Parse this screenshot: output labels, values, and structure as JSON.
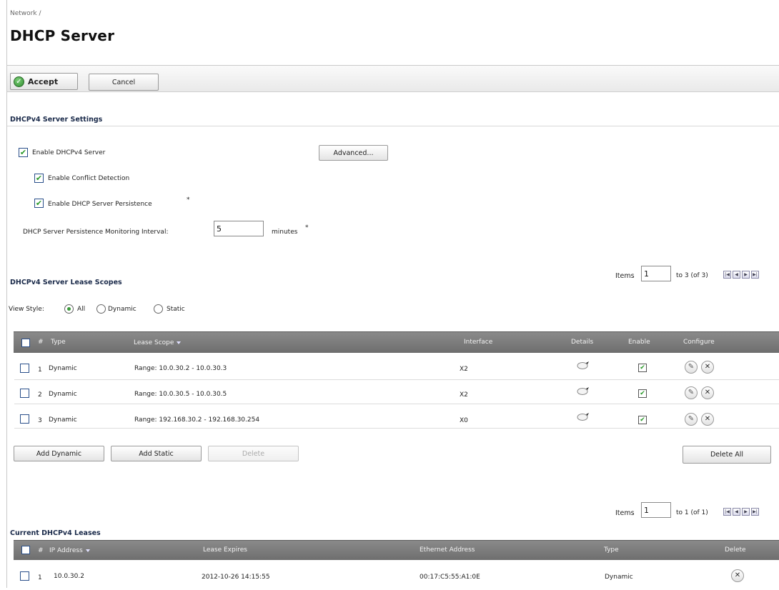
{
  "breadcrumb": "Network /",
  "page_title": "DHCP Server",
  "toolbar": {
    "accept_label": "Accept",
    "cancel_label": "Cancel"
  },
  "v4_settings": {
    "title": "DHCPv4 Server Settings",
    "enable_server": {
      "label": "Enable DHCPv4 Server",
      "checked": true
    },
    "advanced_label": "Advanced...",
    "conflict_detection": {
      "label": "Enable Conflict Detection",
      "checked": true
    },
    "persistence": {
      "label": "Enable DHCP Server Persistence",
      "checked": true,
      "asterisk": "*"
    },
    "interval": {
      "label": "DHCP Server Persistence Monitoring Interval:",
      "value": "5",
      "unit": "minutes",
      "asterisk": "*"
    }
  },
  "scopes": {
    "title": "DHCPv4 Server Lease Scopes",
    "pager": {
      "items_label": "Items",
      "current": "1",
      "range_text": "to 3 (of 3)"
    },
    "view_style": {
      "label": "View Style:",
      "options": [
        "All",
        "Dynamic",
        "Static"
      ],
      "selected": "All"
    },
    "columns": {
      "num": "#",
      "type": "Type",
      "lease_scope": "Lease Scope",
      "interface": "Interface",
      "details": "Details",
      "enable": "Enable",
      "configure": "Configure"
    },
    "rows": [
      {
        "num": "1",
        "type": "Dynamic",
        "lease_scope": "Range: 10.0.30.2 - 10.0.30.3",
        "interface": "X2",
        "enabled": true
      },
      {
        "num": "2",
        "type": "Dynamic",
        "lease_scope": "Range: 10.0.30.5 - 10.0.30.5",
        "interface": "X2",
        "enabled": true
      },
      {
        "num": "3",
        "type": "Dynamic",
        "lease_scope": "Range: 192.168.30.2 - 192.168.30.254",
        "interface": "X0",
        "enabled": true
      }
    ],
    "buttons": {
      "add_dynamic": "Add Dynamic",
      "add_static": "Add Static",
      "delete": "Delete",
      "delete_all": "Delete All"
    }
  },
  "leases": {
    "title": "Current DHCPv4 Leases",
    "pager": {
      "items_label": "Items",
      "current": "1",
      "range_text": "to 1 (of 1)"
    },
    "columns": {
      "num": "#",
      "ip": "IP Address",
      "expires": "Lease Expires",
      "ethernet": "Ethernet Address",
      "type": "Type",
      "delete": "Delete"
    },
    "rows": [
      {
        "num": "1",
        "ip": "10.0.30.2",
        "expires": "2012-10-26 14:15:55",
        "ethernet": "00:17:C5:55:A1:0E",
        "type": "Dynamic"
      }
    ]
  },
  "icons": {
    "accept": "check-circle-icon",
    "details": "comment-bubble-icon",
    "edit": "pencil-icon",
    "delete": "x-circle-icon",
    "pager_first": "first-page-icon",
    "pager_prev": "prev-page-icon",
    "pager_next": "next-page-icon",
    "pager_last": "last-page-icon"
  },
  "colors": {
    "accent_green": "#2e8b2e",
    "header_gray": "#7a7a7a",
    "title_navy": "#1a2a4a"
  }
}
